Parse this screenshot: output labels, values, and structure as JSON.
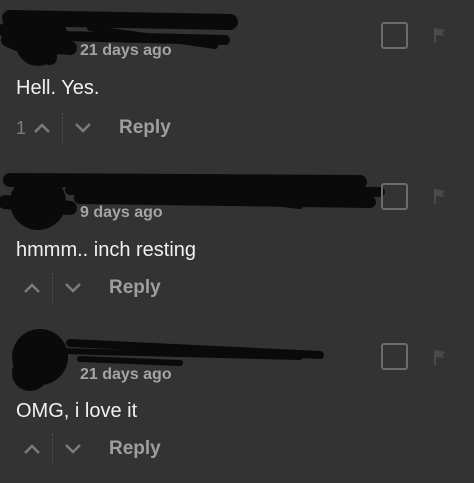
{
  "comments": [
    {
      "timestamp": "21 days ago",
      "text": "Hell. Yes.",
      "votes": "1",
      "reply_label": "Reply"
    },
    {
      "timestamp": "9 days ago",
      "text": "hmmm.. inch resting",
      "votes": "",
      "reply_label": "Reply"
    },
    {
      "timestamp": "21 days ago",
      "text": "OMG, i love it",
      "votes": "",
      "reply_label": "Reply"
    }
  ],
  "icons": {
    "upvote": "chevron-up-icon",
    "downvote": "chevron-down-icon",
    "flag": "flag-icon",
    "select": "checkbox"
  },
  "colors": {
    "background": "#333333",
    "text": "#f0f0f0",
    "muted": "#a4a4a4",
    "redaction": "#0a0a0a"
  }
}
